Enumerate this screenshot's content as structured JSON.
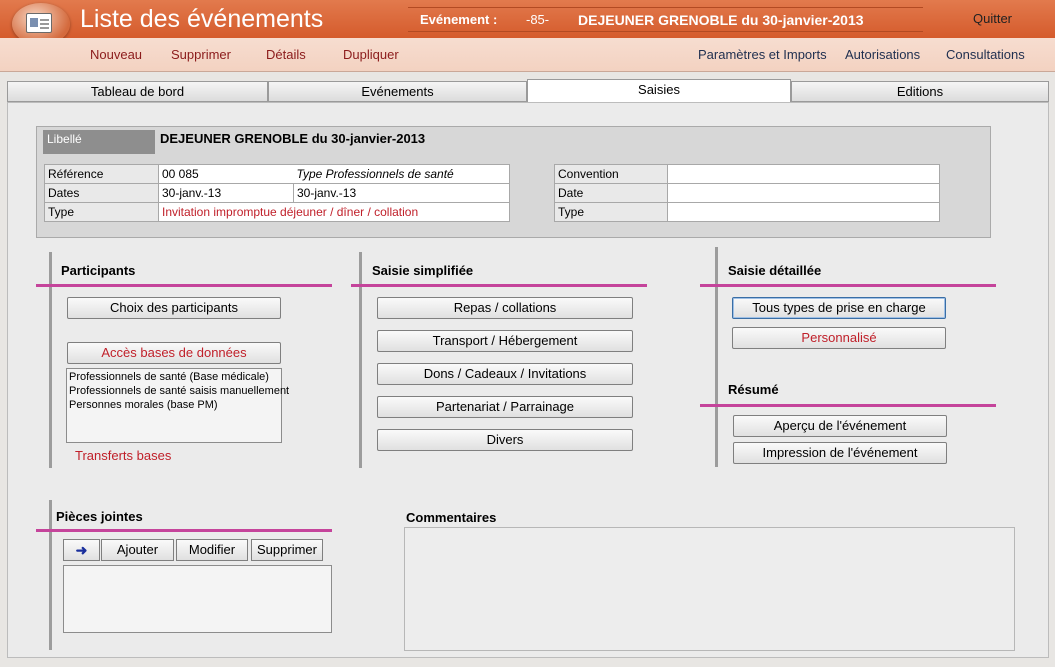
{
  "header": {
    "title": "Liste des événements",
    "event_label": "Evénement :",
    "event_number": "-85-",
    "event_name": "DEJEUNER GRENOBLE du 30-janvier-2013",
    "quit": "Quitter"
  },
  "menu": {
    "left": [
      "Nouveau",
      "Supprimer",
      "Détails",
      "Dupliquer"
    ],
    "right": [
      "Paramètres et Imports",
      "Autorisations",
      "Consultations"
    ]
  },
  "tabs": [
    "Tableau de bord",
    "Evénements",
    "Saisies",
    "Editions"
  ],
  "active_tab": "Saisies",
  "info": {
    "libelle_label": "Libellé",
    "libelle_value": "DEJEUNER GRENOBLE du 30-janvier-2013",
    "reference_label": "Référence",
    "reference_value": "00 085",
    "type_pro": "Type Professionnels de santé",
    "dates_label": "Dates",
    "date_start": "30-janv.-13",
    "date_end": "30-janv.-13",
    "type_label": "Type",
    "type_value": "Invitation impromptue déjeuner / dîner / collation",
    "convention_label": "Convention",
    "convention_value": "",
    "date_label": "Date",
    "date_value": "",
    "type2_label": "Type",
    "type2_value": ""
  },
  "participants": {
    "title": "Participants",
    "choose_btn": "Choix des participants",
    "db_btn": "Accès bases de données",
    "list": [
      "Professionnels de santé (Base médicale)",
      "Professionnels de santé saisis manuellement",
      "Personnes morales (base PM)"
    ],
    "transfer_link": "Transferts bases"
  },
  "saisie_simplifiee": {
    "title": "Saisie simplifiée",
    "buttons": [
      "Repas / collations",
      "Transport / Hébergement",
      "Dons / Cadeaux / Invitations",
      "Partenariat / Parrainage",
      "Divers"
    ]
  },
  "saisie_detaillee": {
    "title": "Saisie détaillée",
    "all_types_btn": "Tous types de prise en charge",
    "custom_btn": "Personnalisé"
  },
  "resume": {
    "title": "Résumé",
    "preview_btn": "Aperçu de l'événement",
    "print_btn": "Impression de l'événement"
  },
  "attachments": {
    "title": "Pièces jointes",
    "add": "Ajouter",
    "edit": "Modifier",
    "delete": "Supprimer"
  },
  "comments": {
    "title": "Commentaires"
  },
  "colors": {
    "header_orange": "#d55b2c",
    "menu_bg": "#f3d2c1",
    "section_line": "#c5449b",
    "red_text": "#c0202a"
  }
}
